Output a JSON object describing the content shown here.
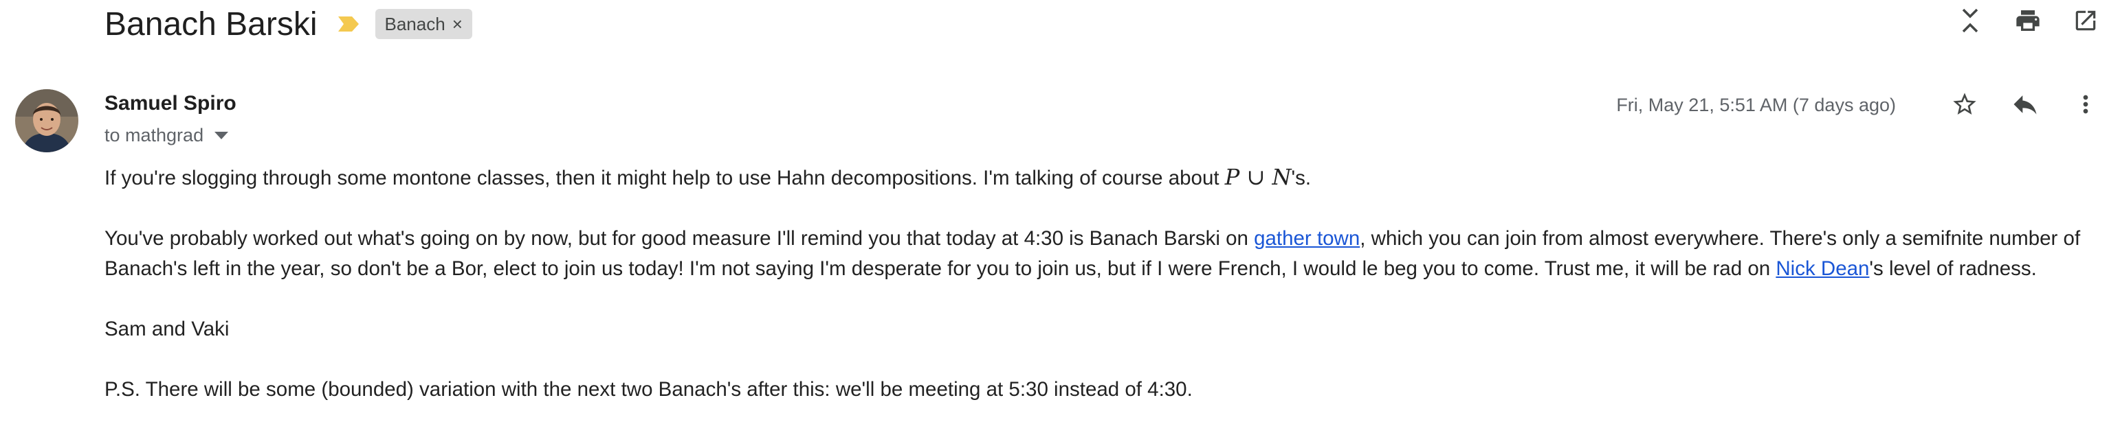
{
  "subject": "Banach Barski",
  "label": "Banach",
  "label_remove": "×",
  "sender": {
    "name": "Samuel Spiro",
    "to": "to mathgrad"
  },
  "date": "Fri, May 21, 5:51 AM (7 days ago)",
  "icons": {
    "collapse": "collapse-icon",
    "print": "print-icon",
    "open_new": "open-in-new-icon",
    "star": "star-icon",
    "reply": "reply-icon",
    "more": "more-vert-icon",
    "importance": "importance-marker-icon",
    "caret": "caret-down-icon"
  },
  "colors": {
    "importance": "#f4c950",
    "link": "#1a56d6",
    "chip": "#dddddd"
  },
  "body": {
    "p1_before": "If you're slogging through some montone classes, then it might help to use Hahn decompositions.  I'm talking of course about ",
    "p1_math_p": "P",
    "p1_math_cup": " ∪ ",
    "p1_math_n": "N",
    "p1_after": "'s.",
    "p2_a": "You've probably worked out what's going on by now, but for good measure I'll remind you that today at 4:30 is Banach Barski on ",
    "p2_link1": "gather town",
    "p2_b": ", which you can join from almost everywhere.  There's only a semifnite number of Banach's left in the year, so don't be a Bor, elect to join us today!  I'm not saying I'm desperate for you to join us, but if I were French, I would le beg you to come.  Trust me, it will be rad on ",
    "p2_link2": "Nick Dean",
    "p2_c": "'s level of radness.",
    "p3": "Sam and Vaki",
    "p4": "P.S.  There will be some (bounded) variation with the next two Banach's after this: we'll be meeting at 5:30 instead of 4:30."
  }
}
